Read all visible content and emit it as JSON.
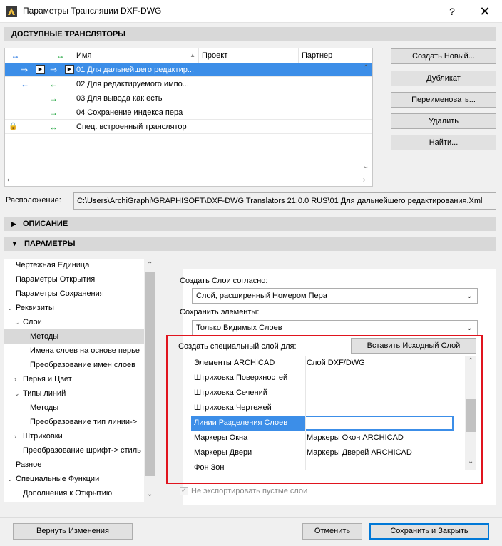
{
  "window": {
    "title": "Параметры Трансляции DXF-DWG",
    "help_glyph": "?",
    "close_glyph": "✕"
  },
  "sections": {
    "translators": "ДОСТУПНЫЕ ТРАНСЛЯТОРЫ",
    "description": "ОПИСАНИЕ",
    "parameters": "ПАРАМЕТРЫ"
  },
  "translators_table": {
    "columns": [
      "Имя",
      "Проект",
      "Партнер"
    ],
    "rows": [
      {
        "name": "01 Для дальнейшего редактир...",
        "selected": true
      },
      {
        "name": "02 Для редактируемого импо...",
        "selected": false
      },
      {
        "name": "03 Для вывода как есть",
        "selected": false
      },
      {
        "name": "04 Сохранение индекса пера",
        "selected": false
      },
      {
        "name": "Спец. встроенный транслятор",
        "selected": false
      }
    ]
  },
  "translator_buttons": {
    "new": "Создать Новый...",
    "duplicate": "Дубликат",
    "rename": "Переименовать...",
    "delete": "Удалить",
    "find": "Найти..."
  },
  "location": {
    "label": "Расположение:",
    "path": "C:\\Users\\ArchiGraphi\\GRAPHISOFT\\DXF-DWG Translators 21.0.0 RUS\\01 Для дальнейшего редактирования.Xml"
  },
  "tree": {
    "items": [
      {
        "label": "Чертежная Единица"
      },
      {
        "label": "Параметры Открытия"
      },
      {
        "label": "Параметры Сохранения"
      },
      {
        "label": "Реквизиты"
      },
      {
        "label": "Слои"
      },
      {
        "label": "Методы"
      },
      {
        "label": "Имена слоев на основе перье"
      },
      {
        "label": "Преобразование имен слоев"
      },
      {
        "label": "Перья и Цвет"
      },
      {
        "label": "Типы линий"
      },
      {
        "label": "Методы"
      },
      {
        "label": "Преобразование тип линии->"
      },
      {
        "label": "Штриховки"
      },
      {
        "label": "Преобразование шрифт-> стиль"
      },
      {
        "label": "Разное"
      },
      {
        "label": "Специальные Функции"
      },
      {
        "label": "Дополнения к Открытию"
      }
    ]
  },
  "params": {
    "create_layers_label": "Создать Слои согласно:",
    "create_layers_value": "Слой, расширенный Номером Пера",
    "save_elements_label": "Сохранить элементы:",
    "save_elements_value": "Только Видимых Слоев",
    "special_layer_label": "Создать специальный слой для:",
    "insert_source_layer": "Вставить Исходный Слой",
    "layer_rows": [
      {
        "element": "Элементы ARCHICAD",
        "layer": "Слой DXF/DWG"
      },
      {
        "element": "Штриховка Поверхностей",
        "layer": ""
      },
      {
        "element": "Штриховка Сечений",
        "layer": ""
      },
      {
        "element": "Штриховка Чертежей",
        "layer": ""
      },
      {
        "element": "Линии Разделения Слоев",
        "layer": ""
      },
      {
        "element": "Маркеры Окна",
        "layer": "Маркеры Окон ARCHICAD"
      },
      {
        "element": "Маркеры Двери",
        "layer": "Маркеры Дверей ARCHICAD"
      },
      {
        "element": "Фон Зон",
        "layer": ""
      }
    ],
    "skip_empty_layers": "Не экспортировать пустые слои",
    "check_glyph": "✓"
  },
  "footer": {
    "revert": "Вернуть Изменения",
    "cancel": "Отменить",
    "save_close": "Сохранить и Закрыть"
  },
  "icons": {
    "two_way": "↔",
    "left": "←",
    "right": "→",
    "import": "⇒",
    "play": "▶",
    "expand": "›",
    "collapse": "⌄",
    "sort_up": "▲",
    "scroll_up": "⌃",
    "scroll_down": "⌄",
    "scroll_left": "‹",
    "scroll_right": "›",
    "section_collapsed": "▶",
    "section_expanded": "▼",
    "combo_chevron": "⌄",
    "lock": "🔒"
  },
  "colors": {
    "selection": "#3c8ee8",
    "highlight_border": "#e0141e",
    "arrow_blue": "#1a6fe0",
    "arrow_green": "#1ba23a"
  }
}
